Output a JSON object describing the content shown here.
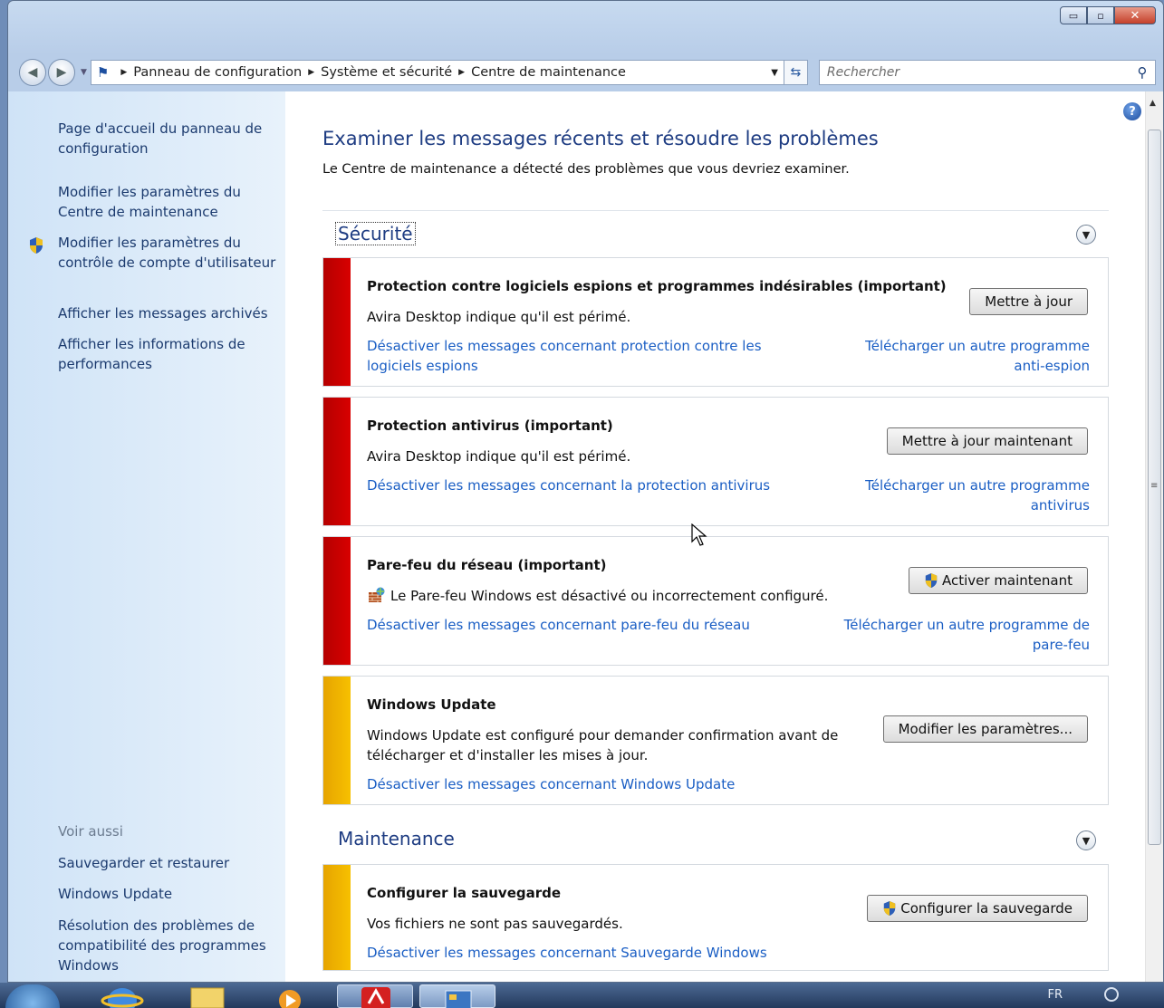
{
  "window": {
    "controls": {
      "minimize": "▭",
      "maximize": "▫",
      "close": "✕"
    }
  },
  "nav": {
    "back_icon": "back-arrow-icon",
    "forward_icon": "forward-arrow-icon",
    "breadcrumbs": [
      "Panneau de configuration",
      "Système et sécurité",
      "Centre de maintenance"
    ],
    "search_placeholder": "Rechercher"
  },
  "sidebar": {
    "links": [
      "Page d'accueil du panneau de configuration",
      "Modifier les paramètres du Centre de maintenance",
      "Modifier les paramètres du contrôle de compte d'utilisateur",
      "Afficher les messages archivés",
      "Afficher les informations de performances"
    ],
    "see_also_label": "Voir aussi",
    "see_also": [
      "Sauvegarder et restaurer",
      "Windows Update",
      "Résolution des problèmes de compatibilité des programmes Windows"
    ]
  },
  "main": {
    "title": "Examiner les messages récents et résoudre les problèmes",
    "subtitle": "Le Centre de maintenance a détecté des problèmes que vous devriez examiner.",
    "security_header": "Sécurité",
    "maintenance_header": "Maintenance",
    "cards": [
      {
        "title": "Protection contre logiciels espions et programmes indésirables (important)",
        "text": "Avira Desktop indique qu'il est périmé.",
        "link": "Désactiver les messages concernant protection contre les logiciels espions",
        "link2": "Télécharger un autre programme anti-espion",
        "button": "Mettre à jour",
        "severity": "red"
      },
      {
        "title": "Protection antivirus (important)",
        "text": "Avira Desktop indique qu'il est périmé.",
        "link": "Désactiver les messages concernant la protection antivirus",
        "link2": "Télécharger un autre programme antivirus",
        "button": "Mettre à jour maintenant",
        "severity": "red"
      },
      {
        "title": "Pare-feu du réseau (important)",
        "text": "Le Pare-feu Windows est désactivé ou incorrectement configuré.",
        "link": "Désactiver les messages concernant pare-feu du réseau",
        "link2": "Télécharger un autre programme de pare-feu",
        "button": "Activer maintenant",
        "severity": "red"
      },
      {
        "title": "Windows Update",
        "text": "Windows Update est configuré pour demander confirmation avant de télécharger et d'installer les mises à jour.",
        "link": "Désactiver les messages concernant Windows Update",
        "button": "Modifier les paramètres...",
        "severity": "yellow"
      },
      {
        "title": "Configurer la sauvegarde",
        "text": "Vos fichiers ne sont pas sauvegardés.",
        "link": "Désactiver les messages concernant Sauvegarde Windows",
        "button": "Configurer la sauvegarde",
        "severity": "yellow"
      }
    ]
  },
  "taskbar": {
    "language": "FR"
  },
  "colors": {
    "critical": "#c80000",
    "warning": "#f2b700",
    "link": "#1a5ec4",
    "heading": "#1e3c82"
  }
}
